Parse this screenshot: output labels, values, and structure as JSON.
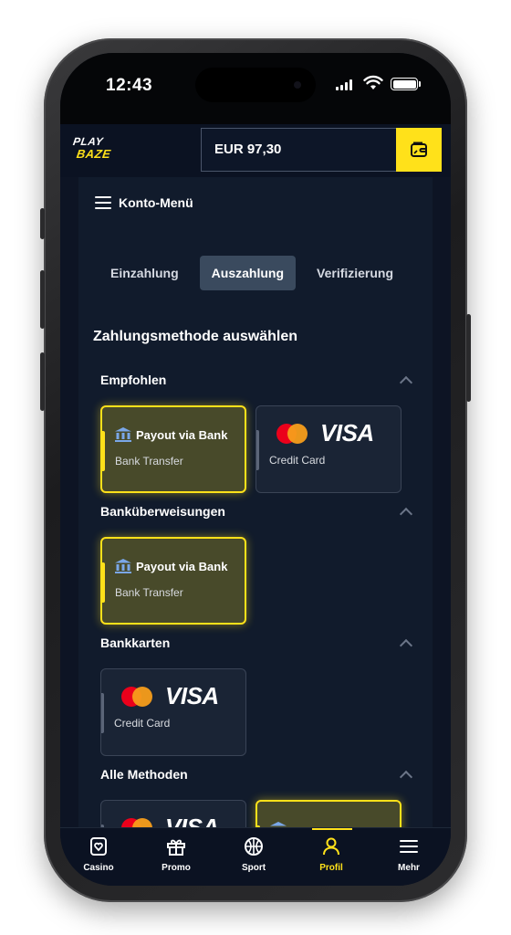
{
  "status_bar": {
    "time": "12:43"
  },
  "header": {
    "logo_top": "PLAY",
    "logo_bottom": "BAZE",
    "balance": "EUR 97,30"
  },
  "menu": {
    "label": "Konto-Menü"
  },
  "tabs": [
    {
      "label": "Einzahlung",
      "active": false
    },
    {
      "label": "Auszahlung",
      "active": true
    },
    {
      "label": "Verifizierung",
      "active": false
    }
  ],
  "section_title": "Zahlungsmethode auswählen",
  "groups": [
    {
      "title": "Empfohlen"
    },
    {
      "title": "Banküberweisungen"
    },
    {
      "title": "Bankkarten"
    },
    {
      "title": "Alle Methoden"
    }
  ],
  "cards": {
    "bank_title": "Payout via Bank",
    "bank_sub": "Bank Transfer",
    "visa_logo": "VISA",
    "card_sub": "Credit Card"
  },
  "bottom_nav": [
    {
      "label": "Casino"
    },
    {
      "label": "Promo"
    },
    {
      "label": "Sport"
    },
    {
      "label": "Profil",
      "active": true
    },
    {
      "label": "Mehr"
    }
  ],
  "colors": {
    "accent": "#ffe11a",
    "background": "#0d1424",
    "panel": "#111b2c"
  }
}
